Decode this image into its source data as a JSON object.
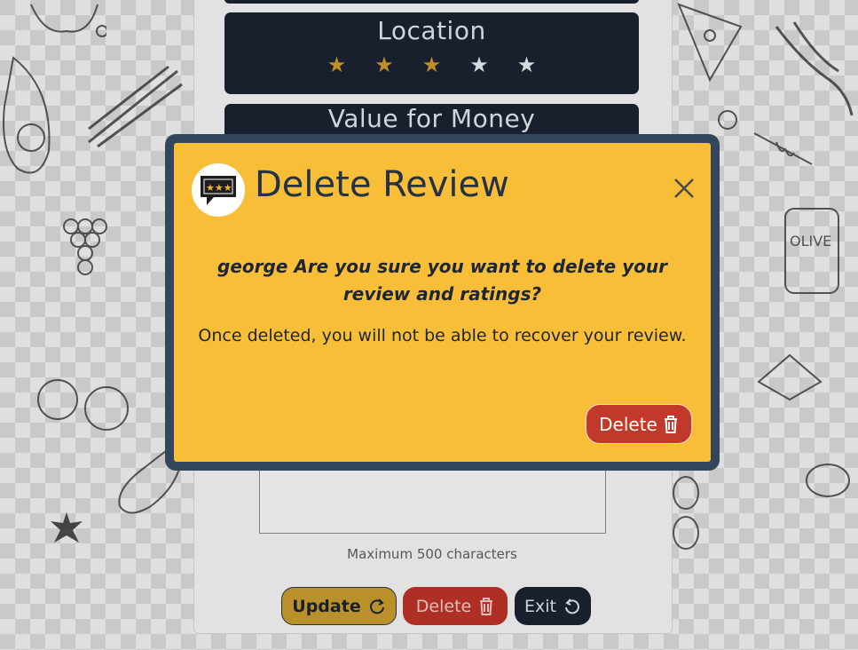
{
  "cards": {
    "location": {
      "title": "Location",
      "rating": 3,
      "max": 5
    },
    "value_for_money": {
      "title": "Value for Money"
    }
  },
  "form": {
    "max_chars_note": "Maximum 500 characters",
    "update_label": "Update",
    "delete_label": "Delete",
    "exit_label": "Exit"
  },
  "modal": {
    "title": "Delete Review",
    "question": "george Are you sure you want to delete your review and ratings?",
    "info": "Once deleted, you will not be able to recover your review.",
    "delete_label": "Delete",
    "close_icon": "close-icon",
    "logo_icon": "review-logo-icon"
  },
  "colors": {
    "card_bg": "#19212f",
    "star_filled": "#c9952c",
    "star_empty": "#dfe3e9",
    "modal_bg": "#f8be38",
    "modal_frame": "#33465c",
    "danger": "#c0392b",
    "update": "#c2962d"
  },
  "icons": {
    "update": "refresh-icon",
    "delete": "trash-icon",
    "exit": "undo-icon"
  }
}
